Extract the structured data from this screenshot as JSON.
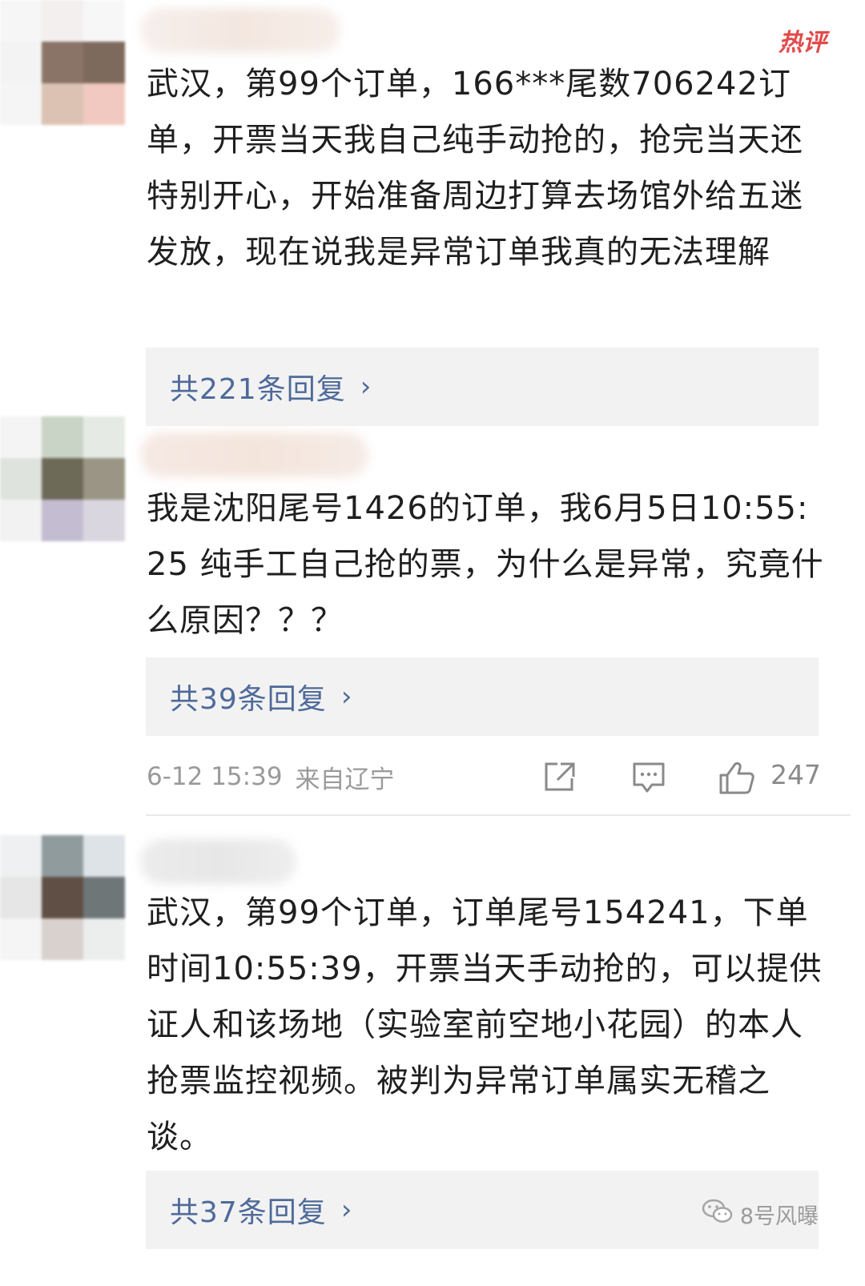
{
  "comments": [
    {
      "badge": "热评",
      "text": "武汉，第99个订单，166***尾数706242订单，开票当天我自己纯手动抢的，抢完当天还特别开心，开始准备周边打算去场馆外给五迷发放，现在说我是异常订单我真的无法理解",
      "replies": "共221条回复"
    },
    {
      "text": "我是沈阳尾号1426的订单，我6月5日10:55:25 纯手工自己抢的票，为什么是异常，究竟什么原因？？？",
      "replies": "共39条回复",
      "time": "6-12 15:39",
      "location": "来自辽宁",
      "likes": "247"
    },
    {
      "text": "武汉，第99个订单，订单尾号154241，下单时间10:55:39，开票当天手动抢的，可以提供证人和该场地（实验室前空地小花园）的本人抢票监控视频。被判为异常订单属实无稽之谈。",
      "replies": "共37条回复"
    }
  ],
  "watermark": "8号风曝",
  "icons": {
    "share": "share-icon",
    "comment": "comment-icon",
    "like": "thumbs-up-icon",
    "chevron": "chevron-right-icon",
    "wechat": "wechat-icon"
  },
  "colors": {
    "reply_link": "#4f6a9a",
    "hot_badge": "#e24a4a",
    "meta": "#9a9a9a",
    "reply_bg": "#f2f2f2"
  }
}
